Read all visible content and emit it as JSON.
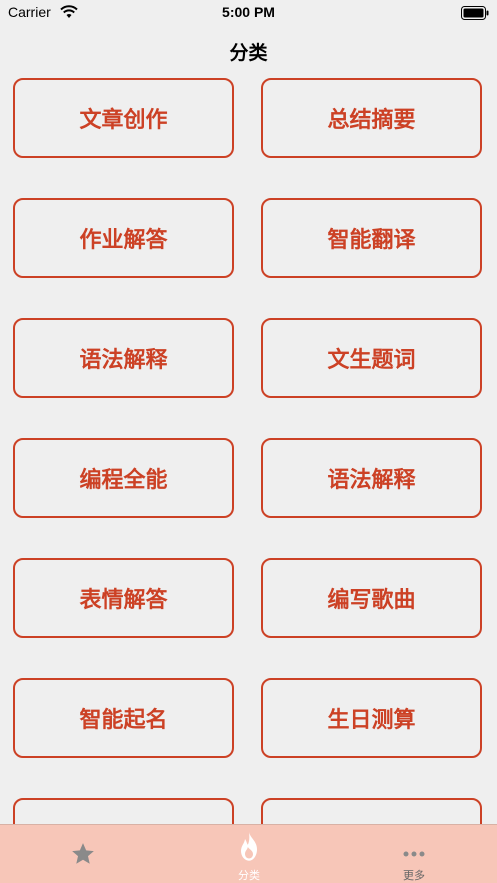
{
  "status_bar": {
    "carrier": "Carrier",
    "time": "5:00 PM"
  },
  "nav": {
    "title": "分类"
  },
  "categories": [
    "文章创作",
    "总结摘要",
    "作业解答",
    "智能翻译",
    "语法解释",
    "文生题词",
    "编程全能",
    "语法解释",
    "表情解答",
    "编写歌曲",
    "智能起名",
    "生日测算",
    "",
    ""
  ],
  "tab_bar": {
    "tabs": [
      {
        "label": "",
        "icon": "star-icon",
        "active": false
      },
      {
        "label": "分类",
        "icon": "flame-icon",
        "active": true
      },
      {
        "label": "更多",
        "icon": "more-dots-icon",
        "active": false
      }
    ]
  },
  "colors": {
    "accent": "#cc4125",
    "background": "#efefef",
    "tab_bar_bg": "#f7c6b8"
  }
}
